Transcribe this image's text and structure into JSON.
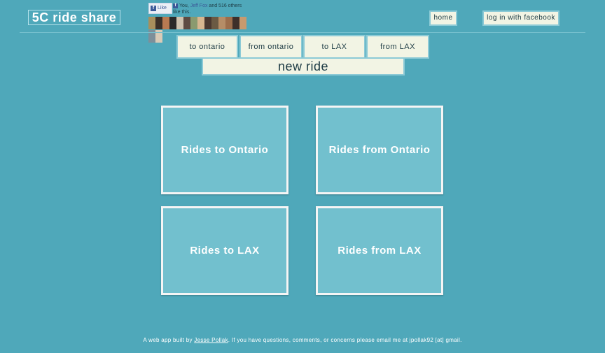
{
  "brand": "5C ride share",
  "facebook": {
    "like_label": "Like",
    "like_icon": "facebook-f-icon",
    "social_prefix": "You, ",
    "friend_name": "Jeff Fox",
    "social_suffix": " and 516 others like this."
  },
  "top_nav": {
    "home": "home",
    "login": "log in with facebook"
  },
  "nav": {
    "to_ontario": "to ontario",
    "from_ontario": "from ontario",
    "to_lax": "to LAX",
    "from_lax": "from LAX",
    "new_ride": "new ride"
  },
  "cards": {
    "to_ontario": "Rides to Ontario",
    "from_ontario": "Rides from Ontario",
    "to_lax": "Rides to LAX",
    "from_lax": "Rides from LAX"
  },
  "footer": {
    "prefix": "A web app built by ",
    "author": "Jesse Pollak",
    "suffix": ". If you have questions, comments, or concerns please email me at jpollak92 [at] gmail."
  },
  "colors": {
    "background": "#4fa8ba",
    "card": "#72c0ce",
    "button": "#f2f4e4",
    "text": "#1d3b44"
  }
}
